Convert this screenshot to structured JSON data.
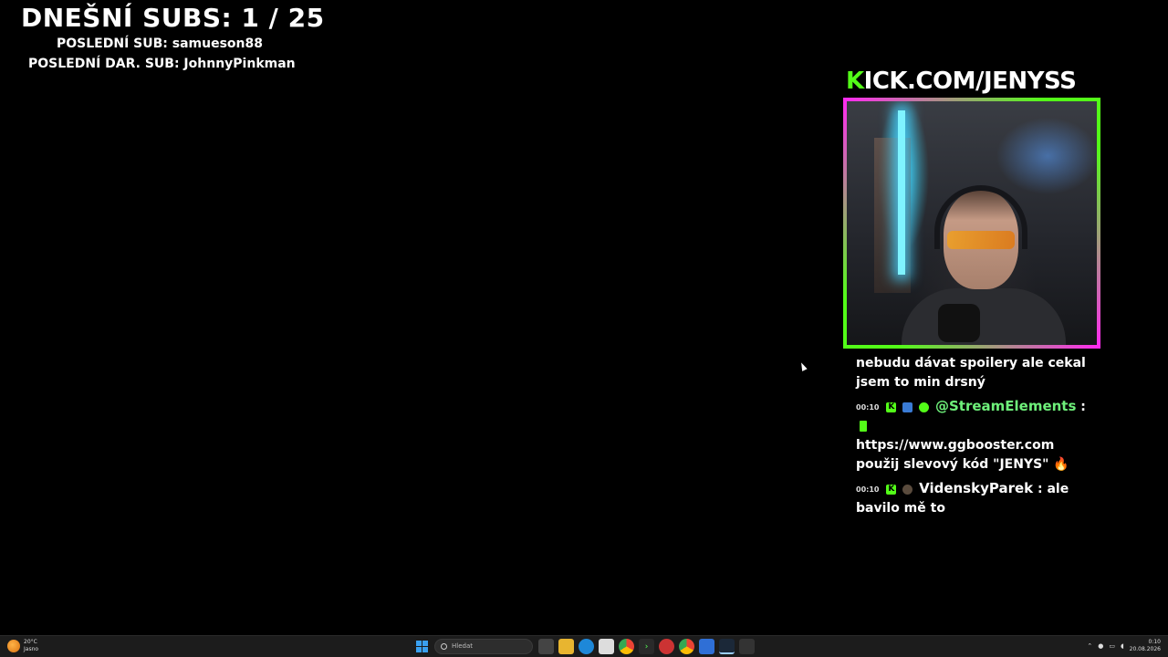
{
  "overlay": {
    "subs_title": "DNEŠNÍ SUBS: 1 / 25",
    "last_sub": "POSLEDNÍ SUB: samueson88",
    "last_gift_sub": "POSLEDNÍ DAR. SUB: JohnnyPinkman"
  },
  "kick_banner": {
    "k": "K",
    "rest": "ICK.COM/JENYSS"
  },
  "chat": {
    "partial_message": "nebudu dávat spoilery ale cekal jsem to min drsný",
    "messages": [
      {
        "time": "00:10",
        "user": "@StreamElements",
        "separator": " : ",
        "text": "https://www.ggbooster.com použij slevový kód \"JENYS\"",
        "emoji": "🔥"
      },
      {
        "time": "00:10",
        "user": "VidenskyParek",
        "separator": " : ",
        "text": "ale bavilo mě to"
      }
    ]
  },
  "taskbar": {
    "weather_temp": "20°C",
    "weather_desc": "Jasno",
    "search_placeholder": "Hledat",
    "clock_time": "0:10",
    "clock_date": "20.08.2026"
  },
  "colors": {
    "kick_green": "#53fc18",
    "frame_pink": "#ff2bf0",
    "streamelements_name": "#6ef07a"
  }
}
